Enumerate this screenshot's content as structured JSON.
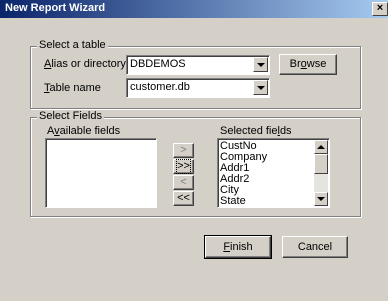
{
  "window": {
    "title": "New Report Wizard",
    "close_glyph": "×"
  },
  "select_table": {
    "group_title": "Select a table",
    "alias_label_mnemonic": "A",
    "alias_label_rest": "lias or directory",
    "alias_value": "DBDEMOS",
    "table_label_mnemonic": "T",
    "table_label_rest": "able name",
    "table_value": "customer.db",
    "browse_pre": "Br",
    "browse_mnemonic": "o",
    "browse_post": "wse"
  },
  "select_fields": {
    "group_title": "Select Fields",
    "available_pre": "A",
    "available_mnemonic": "v",
    "available_post": "ailable fields",
    "selected_pre": "Selected fie",
    "selected_mnemonic": "l",
    "selected_post": "ds",
    "available_items": [],
    "selected_items": [
      "CustNo",
      "Company",
      "Addr1",
      "Addr2",
      "City",
      "State"
    ],
    "move_buttons": [
      ">",
      ">>",
      "<",
      "<<"
    ]
  },
  "footer": {
    "finish_mnemonic": "F",
    "finish_rest": "inish",
    "cancel_label": "Cancel"
  }
}
